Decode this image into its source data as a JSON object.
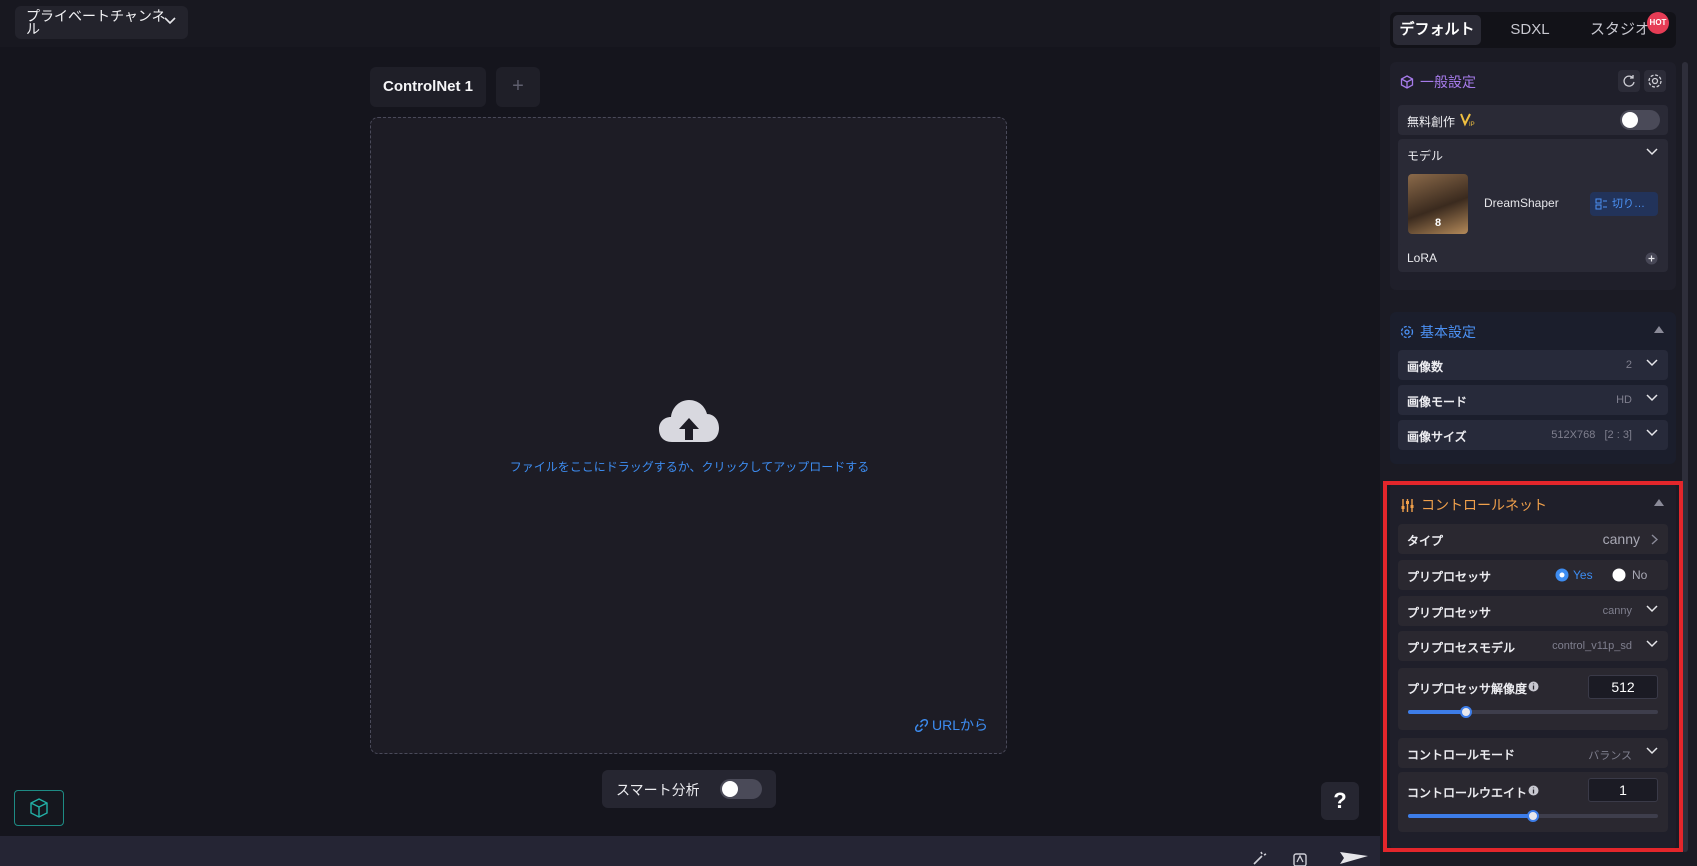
{
  "header": {
    "channel_label": "プライベートチャンネル"
  },
  "main": {
    "tabs": [
      {
        "label": "ControlNet 1"
      },
      {
        "label": "+"
      }
    ],
    "upload_text": "ファイルをここにドラッグするか、クリックしてアップロードする",
    "url_link": "URLから",
    "smart_analysis": {
      "label": "スマート分析",
      "enabled": false
    },
    "help_label": "?"
  },
  "sidebar": {
    "mode_tabs": [
      "デフォルト",
      "SDXL",
      "スタジオ"
    ],
    "hot_badge": "HOT",
    "general": {
      "title": "一般設定",
      "free_creation": {
        "label": "無料創作",
        "enabled": false
      },
      "model_label": "モデル",
      "model": {
        "name": "DreamShaper",
        "version": "8",
        "switch_label": "切り…"
      },
      "lora_label": "LoRA"
    },
    "basic": {
      "title": "基本設定",
      "rows": [
        {
          "label": "画像数",
          "value": "2"
        },
        {
          "label": "画像モード",
          "value": "HD"
        },
        {
          "label": "画像サイズ",
          "value": "512X768   [2 : 3]"
        }
      ]
    },
    "controlnet": {
      "title": "コントロールネット",
      "type": {
        "label": "タイプ",
        "value": "canny"
      },
      "preprocess_toggle": {
        "label": "プリプロセッサ",
        "yes": "Yes",
        "no": "No",
        "selected": "Yes"
      },
      "preprocessor": {
        "label": "プリプロセッサ",
        "value": "canny"
      },
      "preprocess_model": {
        "label": "プリプロセスモデル",
        "value": "control_v11p_sd"
      },
      "resolution": {
        "label": "プリプロセッサ解像度",
        "value": "512",
        "fraction": 0.23
      },
      "control_mode": {
        "label": "コントロールモード",
        "value": "バランス"
      },
      "control_weight": {
        "label": "コントロールウエイト",
        "value": "1",
        "fraction": 0.5
      }
    }
  },
  "colors": {
    "accent": "#3d8cf0",
    "controlnet_title": "#f0a04b",
    "general_title": "#a67bea",
    "highlight": "#e3262b"
  }
}
